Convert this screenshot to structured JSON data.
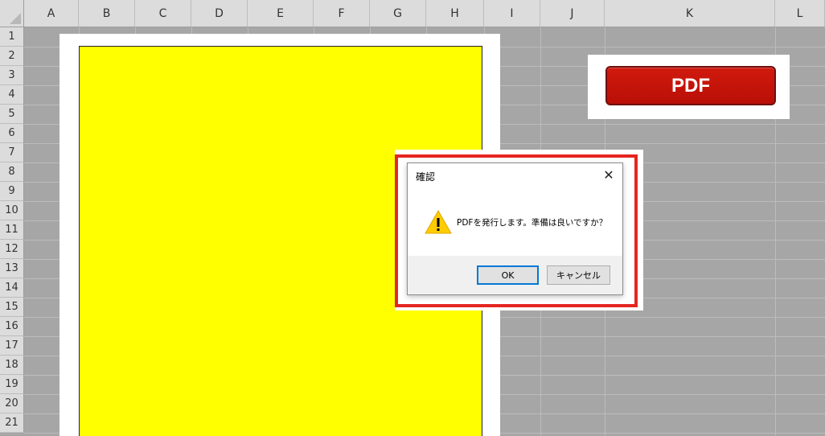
{
  "columns": [
    "A",
    "B",
    "C",
    "D",
    "E",
    "F",
    "G",
    "H",
    "I",
    "J",
    "K",
    "L"
  ],
  "rows": [
    "1",
    "2",
    "3",
    "4",
    "5",
    "6",
    "7",
    "8",
    "9",
    "10",
    "11",
    "12",
    "13",
    "14",
    "15",
    "16",
    "17",
    "18",
    "19",
    "20",
    "21"
  ],
  "pdf_button": {
    "label": "PDF"
  },
  "dialog": {
    "title": "確認",
    "close_symbol": "✕",
    "message": "PDFを発行します。準備は良いですか？",
    "ok_label": "OK",
    "cancel_label": "キャンセル",
    "icon": "warning-icon"
  },
  "colors": {
    "highlight": "#e52521",
    "pdf_button": "#c0140a",
    "cell_fill": "#ffff00",
    "sheet_bg": "#a6a6a6"
  }
}
